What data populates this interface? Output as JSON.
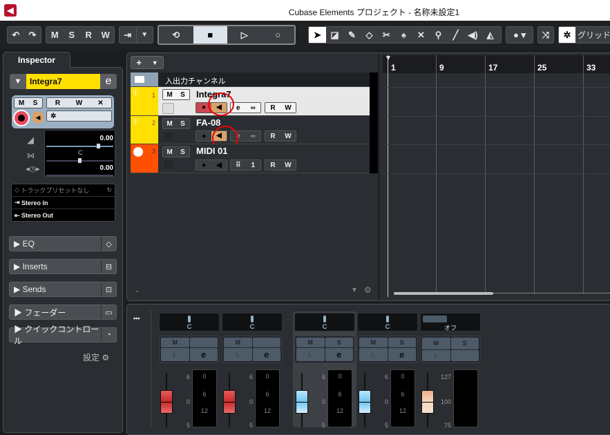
{
  "window": {
    "title": "Cubase Elements プロジェクト - 名称未設定1",
    "logo": "cubase-logo"
  },
  "toolbar": {
    "undo": "↶",
    "redo": "↷",
    "msrw": [
      "M",
      "S",
      "R",
      "W"
    ],
    "transport": {
      "cycle": "⟲",
      "stop": "■",
      "play": "▷",
      "record": "○"
    },
    "tools": [
      "pointer",
      "range",
      "pencil",
      "eraser",
      "split",
      "glue",
      "mute",
      "zoom",
      "line",
      "play",
      "color"
    ],
    "grid_label": "グリッド"
  },
  "inspector": {
    "tab": "Inspector",
    "track_name": "Integra7",
    "buttons": {
      "m": "M",
      "s": "S",
      "r": "R",
      "w": "W"
    },
    "volume": "0.00",
    "pan": "C",
    "delay": "0.00",
    "preset": "トラックプリセットなし",
    "input": "Stereo In",
    "output": "Stereo Out",
    "sections": [
      {
        "label": "EQ",
        "icon": "◇"
      },
      {
        "label": "Inserts",
        "icon": "⊟"
      },
      {
        "label": "Sends",
        "icon": "⊡"
      },
      {
        "label": "フェーダー",
        "icon": "▭"
      },
      {
        "label": "クイックコントロール",
        "icon": "◔"
      }
    ],
    "settings": "設定"
  },
  "tracklist": {
    "add": "+",
    "folder": "入出力チャンネル",
    "tracks": [
      {
        "num": "1",
        "name": "Integra7",
        "type": "audio",
        "color": "#ffe000"
      },
      {
        "num": "2",
        "name": "FA-08",
        "type": "audio",
        "color": "#ffe000"
      },
      {
        "num": "3",
        "name": "MIDI 01",
        "type": "midi",
        "color": "#ff5a00",
        "channel": "1"
      }
    ],
    "footer": "-"
  },
  "ruler": [
    "1",
    "9",
    "17",
    "25",
    "33"
  ],
  "mixer": {
    "more": "•••",
    "channels": [
      {
        "pan": "C",
        "m": "M",
        "s": "",
        "l": "L",
        "e": "e",
        "fader": "red",
        "scale": [
          "6",
          "0",
          "5"
        ],
        "meter": [
          "0",
          "6",
          "12"
        ]
      },
      {
        "pan": "C",
        "m": "M",
        "s": "",
        "l": "L",
        "e": "e",
        "fader": "red",
        "scale": [
          "6",
          "0",
          "5"
        ],
        "meter": [
          "0",
          "6",
          "12"
        ]
      },
      {
        "pan": "C",
        "m": "M",
        "s": "S",
        "l": "L",
        "e": "e",
        "fader": "blue",
        "scale": [
          "6",
          "0",
          "5"
        ],
        "meter": [
          "0",
          "6",
          "12"
        ]
      },
      {
        "pan": "C",
        "m": "M",
        "s": "S",
        "l": "L",
        "e": "e",
        "fader": "blue",
        "scale": [
          "6",
          "0",
          "5"
        ],
        "meter": [
          "0",
          "6",
          "12"
        ]
      },
      {
        "pan": "オフ",
        "m": "M",
        "s": "S",
        "l": "L",
        "e": "",
        "fader": "orange",
        "scale": [
          "127",
          "100",
          "75"
        ],
        "meter": []
      }
    ]
  }
}
